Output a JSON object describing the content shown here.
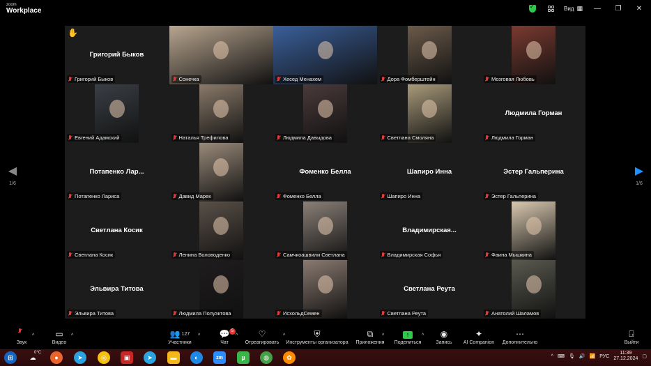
{
  "titlebar": {
    "brand_small": "zoom",
    "brand_big": "Workplace",
    "view_label": "Вид"
  },
  "pager": {
    "left_count": "1/6",
    "right_count": "1/6"
  },
  "tiles": [
    {
      "id": "t01",
      "name": "Григорий Быков",
      "show_name": true,
      "raise_hand": true
    },
    {
      "id": "t02",
      "name": "Сонечка",
      "video": "#b8a58f"
    },
    {
      "id": "t03",
      "name": "Хесед Менахем",
      "video": "#3a5f9a",
      "active": true
    },
    {
      "id": "t04",
      "name": "Дора Фомберштейн",
      "video": "#6b5a4a"
    },
    {
      "id": "t05",
      "name": "Мозговая Любовь",
      "video": "#7a3a30"
    },
    {
      "id": "t06",
      "name": "Евгений Адамский",
      "video": "#3a3f45"
    },
    {
      "id": "t07",
      "name": "Наталья Трефилова",
      "video": "#8a7a6a"
    },
    {
      "id": "t08",
      "name": "Людмила Давыдова",
      "video": "#4a3a3a"
    },
    {
      "id": "t09",
      "name": "Светлана Смоляна",
      "video": "#a89a7a"
    },
    {
      "id": "t10",
      "name": "Людмила Горман",
      "show_name": true
    },
    {
      "id": "t11",
      "name": "Потапенко Лариса",
      "show_name": true,
      "center_name": "Потапенко  Лар..."
    },
    {
      "id": "t12",
      "name": "Давид Марек",
      "video": "#9a8a7a"
    },
    {
      "id": "t13",
      "name": "Фоменко Белла",
      "show_name": true
    },
    {
      "id": "t14",
      "name": "Шапиро Инна",
      "show_name": true
    },
    {
      "id": "t15",
      "name": "Эстер Гальперина",
      "show_name": true
    },
    {
      "id": "t16",
      "name": "Светлана Косик",
      "show_name": true
    },
    {
      "id": "t17",
      "name": "Ленина Воловоденко",
      "video": "#5a5048"
    },
    {
      "id": "t18",
      "name": "Самчкоашвили Светлана",
      "video": "#8a8078"
    },
    {
      "id": "t19",
      "name": "Владимирская Софья",
      "show_name": true,
      "center_name": "Владимирская..."
    },
    {
      "id": "t20",
      "name": "Фаина Мышкина",
      "video": "#d9c9b0"
    },
    {
      "id": "t21",
      "name": "Эльвира Титова",
      "show_name": true
    },
    {
      "id": "t22",
      "name": "Людмила Полуэктова",
      "video": "#1f1c1e"
    },
    {
      "id": "t23",
      "name": "ИсхольдСемен",
      "video": "#8a7a70"
    },
    {
      "id": "t24",
      "name": "Светлана Реута",
      "show_name": true
    },
    {
      "id": "t25",
      "name": "Анатолий Шаламов",
      "video": "#5a5a50"
    }
  ],
  "toolbar": {
    "audio": "Звук",
    "video": "Видео",
    "participants": "Участники",
    "participants_count": "127",
    "chat": "Чат",
    "chat_badge": "5",
    "react": "Отреагировать",
    "host_tools": "Инструменты организатора",
    "apps": "Приложения",
    "share": "Поделиться",
    "record": "Запись",
    "ai": "AI Companion",
    "more": "Дополнительно",
    "leave": "Выйти"
  },
  "taskbar": {
    "weather": "0°C",
    "lang": "РУС",
    "time": "11:39",
    "date": "27.12.2024"
  },
  "colors": {
    "active_speaker": "#2ec94a",
    "muted": "#e53935",
    "pager_active": "#1e90ff"
  }
}
